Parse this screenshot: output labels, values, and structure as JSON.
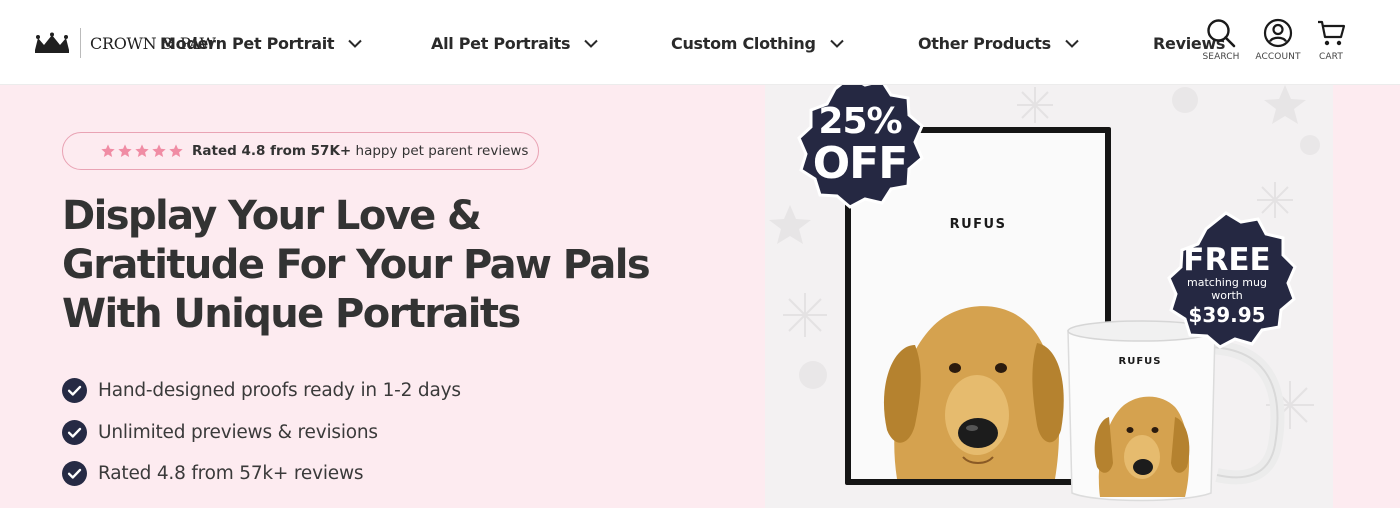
{
  "header": {
    "logo_text": "CROWN & PAW",
    "nav": [
      {
        "label": "Modern Pet Portrait"
      },
      {
        "label": "All Pet Portraits"
      },
      {
        "label": "Custom Clothing"
      },
      {
        "label": "Other Products"
      },
      {
        "label": "Reviews"
      }
    ],
    "icons": [
      {
        "name": "search-icon",
        "label": "SEARCH"
      },
      {
        "name": "account-icon",
        "label": "ACCOUNT"
      },
      {
        "name": "cart-icon",
        "label": "CART"
      }
    ]
  },
  "hero": {
    "rating": {
      "stars": 5,
      "bold": "Rated 4.8 from 57K+",
      "rest": "happy pet parent reviews"
    },
    "title_lines": [
      "Display Your Love &",
      "Gratitude For Your Paw Pals",
      "With Unique Portraits"
    ],
    "bullets": [
      "Hand-designed proofs ready in 1-2 days",
      "Unlimited previews & revisions",
      "Rated 4.8 from 57k+ reviews"
    ]
  },
  "product": {
    "discount_badge": {
      "line1": "25%",
      "line2": "OFF"
    },
    "free_badge": {
      "line1": "FREE",
      "line2": "matching mug",
      "line3": "worth",
      "price": "$39.95"
    },
    "portrait_name": "RUFUS",
    "mug_name": "RUFUS"
  },
  "colors": {
    "hero_bg": "#fdebf0",
    "pill_border": "#e9a3b4",
    "star": "#f08ca4",
    "check_bg": "#262a44",
    "badge_bg": "#252842",
    "text": "#333333"
  }
}
